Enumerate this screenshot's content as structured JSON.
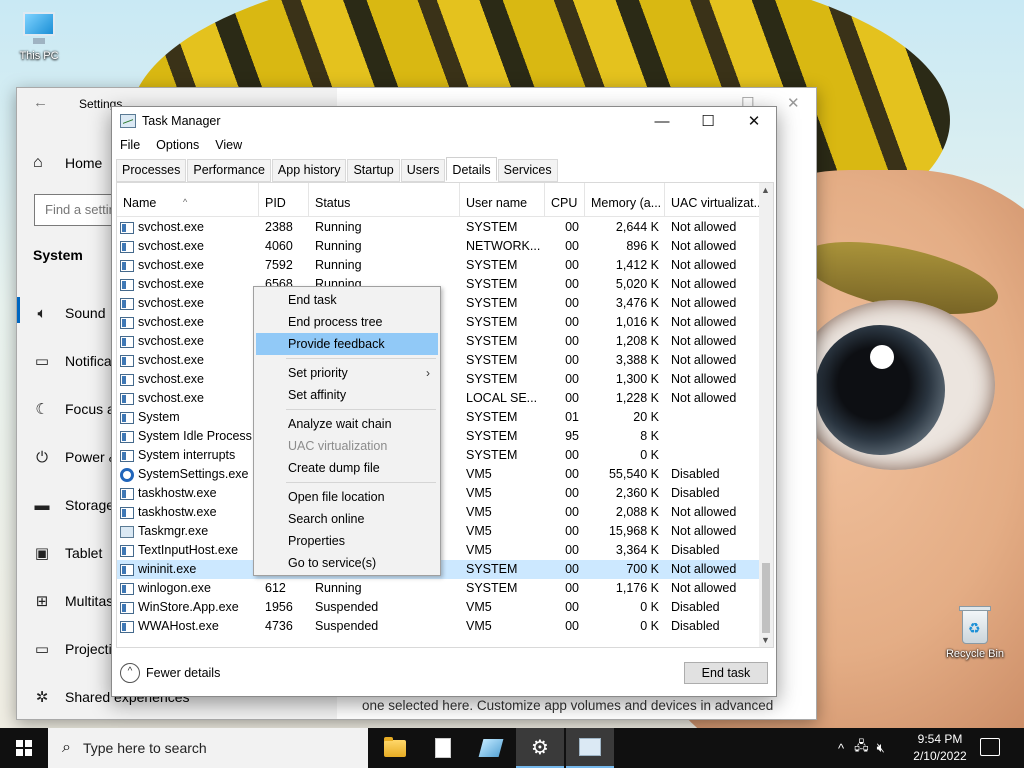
{
  "desktop": {
    "icons": [
      {
        "label": "This PC",
        "icon": "this-pc-icon"
      },
      {
        "label": "Recycle Bin",
        "icon": "recycle-bin-icon"
      }
    ]
  },
  "settings": {
    "title": "Settings",
    "home_label": "Home",
    "search_placeholder": "Find a setting",
    "section": "System",
    "nav": [
      {
        "label": "Sound",
        "icon": "speaker-icon"
      },
      {
        "label": "Notifications & actions",
        "icon": "notification-icon"
      },
      {
        "label": "Focus assist",
        "icon": "moon-icon"
      },
      {
        "label": "Power & sleep",
        "icon": "power-icon"
      },
      {
        "label": "Storage",
        "icon": "storage-icon"
      },
      {
        "label": "Tablet",
        "icon": "tablet-icon"
      },
      {
        "label": "Multitasking",
        "icon": "multitasking-icon"
      },
      {
        "label": "Projecting to this PC",
        "icon": "projecting-icon"
      },
      {
        "label": "Shared experiences",
        "icon": "shared-experiences-icon"
      }
    ],
    "description": "one selected here. Customize app volumes and devices in advanced"
  },
  "task_manager": {
    "title": "Task Manager",
    "menu": [
      "File",
      "Options",
      "View"
    ],
    "tabs": [
      "Processes",
      "Performance",
      "App history",
      "Startup",
      "Users",
      "Details",
      "Services"
    ],
    "active_tab": "Details",
    "columns": [
      "Name",
      "PID",
      "Status",
      "User name",
      "CPU",
      "Memory (a...",
      "UAC virtualizat..."
    ],
    "rows": [
      {
        "name": "svchost.exe",
        "pid": "2388",
        "status": "Running",
        "user": "SYSTEM",
        "cpu": "00",
        "mem": "2,644 K",
        "uac": "Not allowed",
        "icon": "process-icon"
      },
      {
        "name": "svchost.exe",
        "pid": "4060",
        "status": "Running",
        "user": "NETWORK...",
        "cpu": "00",
        "mem": "896 K",
        "uac": "Not allowed",
        "icon": "process-icon"
      },
      {
        "name": "svchost.exe",
        "pid": "7592",
        "status": "Running",
        "user": "SYSTEM",
        "cpu": "00",
        "mem": "1,412 K",
        "uac": "Not allowed",
        "icon": "process-icon"
      },
      {
        "name": "svchost.exe",
        "pid": "6568",
        "status": "Running",
        "user": "SYSTEM",
        "cpu": "00",
        "mem": "5,020 K",
        "uac": "Not allowed",
        "icon": "process-icon"
      },
      {
        "name": "svchost.exe",
        "pid": "",
        "status": "",
        "user": "SYSTEM",
        "cpu": "00",
        "mem": "3,476 K",
        "uac": "Not allowed",
        "icon": "process-icon"
      },
      {
        "name": "svchost.exe",
        "pid": "",
        "status": "",
        "user": "SYSTEM",
        "cpu": "00",
        "mem": "1,016 K",
        "uac": "Not allowed",
        "icon": "process-icon"
      },
      {
        "name": "svchost.exe",
        "pid": "",
        "status": "",
        "user": "SYSTEM",
        "cpu": "00",
        "mem": "1,208 K",
        "uac": "Not allowed",
        "icon": "process-icon"
      },
      {
        "name": "svchost.exe",
        "pid": "",
        "status": "",
        "user": "SYSTEM",
        "cpu": "00",
        "mem": "3,388 K",
        "uac": "Not allowed",
        "icon": "process-icon"
      },
      {
        "name": "svchost.exe",
        "pid": "",
        "status": "",
        "user": "SYSTEM",
        "cpu": "00",
        "mem": "1,300 K",
        "uac": "Not allowed",
        "icon": "process-icon"
      },
      {
        "name": "svchost.exe",
        "pid": "",
        "status": "",
        "user": "LOCAL SE...",
        "cpu": "00",
        "mem": "1,228 K",
        "uac": "Not allowed",
        "icon": "process-icon"
      },
      {
        "name": "System",
        "pid": "",
        "status": "",
        "user": "SYSTEM",
        "cpu": "01",
        "mem": "20 K",
        "uac": "",
        "icon": "process-icon"
      },
      {
        "name": "System Idle Process",
        "pid": "",
        "status": "",
        "user": "SYSTEM",
        "cpu": "95",
        "mem": "8 K",
        "uac": "",
        "icon": "process-icon"
      },
      {
        "name": "System interrupts",
        "pid": "",
        "status": "",
        "user": "SYSTEM",
        "cpu": "00",
        "mem": "0 K",
        "uac": "",
        "icon": "process-icon"
      },
      {
        "name": "SystemSettings.exe",
        "pid": "",
        "status": "",
        "user": "VM5",
        "cpu": "00",
        "mem": "55,540 K",
        "uac": "Disabled",
        "icon": "settings-gear-icon"
      },
      {
        "name": "taskhostw.exe",
        "pid": "",
        "status": "",
        "user": "VM5",
        "cpu": "00",
        "mem": "2,360 K",
        "uac": "Disabled",
        "icon": "process-icon"
      },
      {
        "name": "taskhostw.exe",
        "pid": "",
        "status": "",
        "user": "VM5",
        "cpu": "00",
        "mem": "2,088 K",
        "uac": "Not allowed",
        "icon": "process-icon"
      },
      {
        "name": "Taskmgr.exe",
        "pid": "",
        "status": "",
        "user": "VM5",
        "cpu": "00",
        "mem": "15,968 K",
        "uac": "Not allowed",
        "icon": "task-manager-icon"
      },
      {
        "name": "TextInputHost.exe",
        "pid": "",
        "status": "",
        "user": "VM5",
        "cpu": "00",
        "mem": "3,364 K",
        "uac": "Disabled",
        "icon": "process-icon"
      },
      {
        "name": "wininit.exe",
        "pid": "",
        "status": "",
        "user": "SYSTEM",
        "cpu": "00",
        "mem": "700 K",
        "uac": "Not allowed",
        "icon": "process-icon",
        "selected": true
      },
      {
        "name": "winlogon.exe",
        "pid": "612",
        "status": "Running",
        "user": "SYSTEM",
        "cpu": "00",
        "mem": "1,176 K",
        "uac": "Not allowed",
        "icon": "process-icon"
      },
      {
        "name": "WinStore.App.exe",
        "pid": "1956",
        "status": "Suspended",
        "user": "VM5",
        "cpu": "00",
        "mem": "0 K",
        "uac": "Disabled",
        "icon": "process-icon"
      },
      {
        "name": "WWAHost.exe",
        "pid": "4736",
        "status": "Suspended",
        "user": "VM5",
        "cpu": "00",
        "mem": "0 K",
        "uac": "Disabled",
        "icon": "process-icon"
      }
    ],
    "fewer_details": "Fewer details",
    "end_task_button": "End task"
  },
  "context_menu": {
    "items": [
      {
        "label": "End task",
        "enabled": true
      },
      {
        "label": "End process tree",
        "enabled": true
      },
      {
        "label": "Provide feedback",
        "enabled": true,
        "highlighted": true
      },
      {
        "separator": true
      },
      {
        "label": "Set priority",
        "enabled": true,
        "submenu": true
      },
      {
        "label": "Set affinity",
        "enabled": true
      },
      {
        "separator": true
      },
      {
        "label": "Analyze wait chain",
        "enabled": true
      },
      {
        "label": "UAC virtualization",
        "enabled": false
      },
      {
        "label": "Create dump file",
        "enabled": true
      },
      {
        "separator": true
      },
      {
        "label": "Open file location",
        "enabled": true
      },
      {
        "label": "Search online",
        "enabled": true
      },
      {
        "label": "Properties",
        "enabled": true
      },
      {
        "label": "Go to service(s)",
        "enabled": true
      }
    ]
  },
  "taskbar": {
    "search_placeholder": "Type here to search",
    "apps": [
      "file-explorer-icon",
      "document-icon",
      "notepad-icon",
      "settings-icon",
      "task-manager-icon"
    ],
    "time": "9:54 PM",
    "date": "2/10/2022"
  },
  "colors": {
    "selection": "#cce8ff",
    "menu_highlight": "#91c9f7",
    "taskbar": "#101010"
  }
}
